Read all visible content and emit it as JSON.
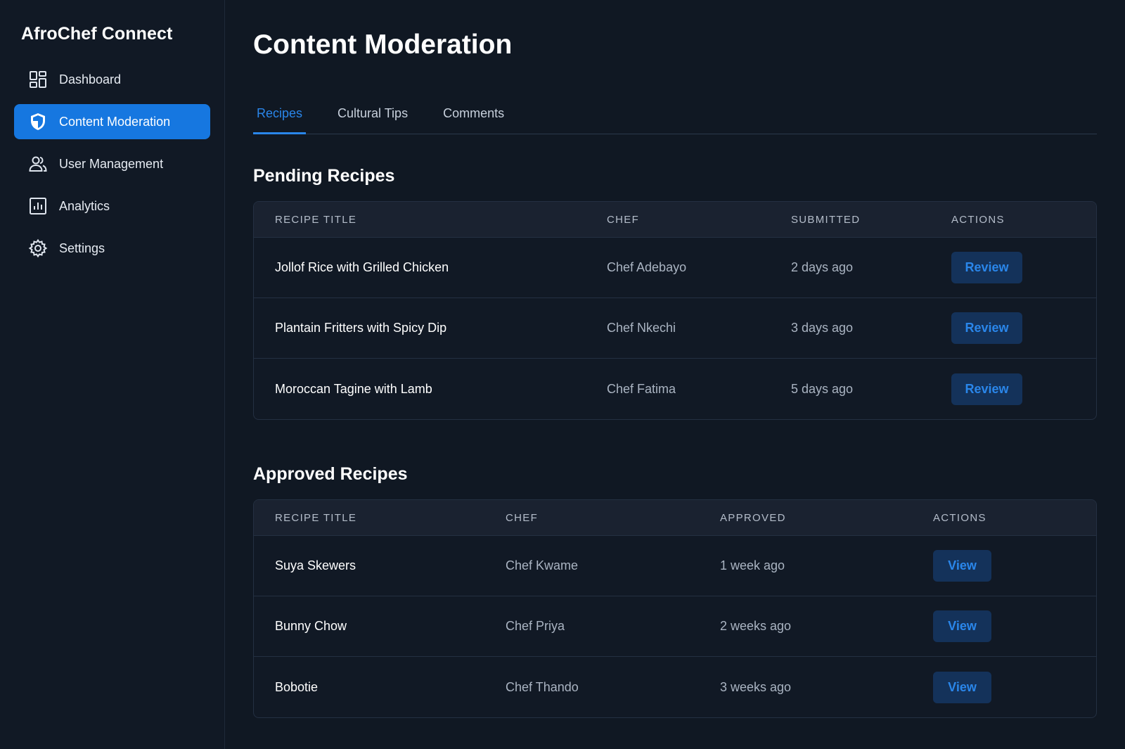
{
  "app": {
    "name": "AfroChef Connect"
  },
  "sidebar": {
    "items": [
      {
        "label": "Dashboard",
        "icon": "dashboard-icon",
        "active": false
      },
      {
        "label": "Content Moderation",
        "icon": "shield-icon",
        "active": true
      },
      {
        "label": "User Management",
        "icon": "users-icon",
        "active": false
      },
      {
        "label": "Analytics",
        "icon": "analytics-icon",
        "active": false
      },
      {
        "label": "Settings",
        "icon": "gear-icon",
        "active": false
      }
    ]
  },
  "page": {
    "title": "Content Moderation"
  },
  "tabs": [
    {
      "label": "Recipes",
      "active": true
    },
    {
      "label": "Cultural Tips",
      "active": false
    },
    {
      "label": "Comments",
      "active": false
    }
  ],
  "pending": {
    "title": "Pending Recipes",
    "headers": [
      "RECIPE TITLE",
      "CHEF",
      "SUBMITTED",
      "ACTIONS"
    ],
    "rows": [
      {
        "title": "Jollof Rice with Grilled Chicken",
        "chef": "Chef Adebayo",
        "when": "2 days ago",
        "action": "Review"
      },
      {
        "title": "Plantain Fritters with Spicy Dip",
        "chef": "Chef Nkechi",
        "when": "3 days ago",
        "action": "Review"
      },
      {
        "title": "Moroccan Tagine with Lamb",
        "chef": "Chef Fatima",
        "when": "5 days ago",
        "action": "Review"
      }
    ]
  },
  "approved": {
    "title": "Approved Recipes",
    "headers": [
      "RECIPE TITLE",
      "CHEF",
      "APPROVED",
      "ACTIONS"
    ],
    "rows": [
      {
        "title": "Suya Skewers",
        "chef": "Chef Kwame",
        "when": "1 week ago",
        "action": "View"
      },
      {
        "title": "Bunny Chow",
        "chef": "Chef Priya",
        "when": "2 weeks ago",
        "action": "View"
      },
      {
        "title": "Bobotie",
        "chef": "Chef Thando",
        "when": "3 weeks ago",
        "action": "View"
      }
    ]
  },
  "colors": {
    "background": "#101823",
    "accent": "#1677e0",
    "link": "#2a86ea",
    "button_bg": "#14325a"
  }
}
